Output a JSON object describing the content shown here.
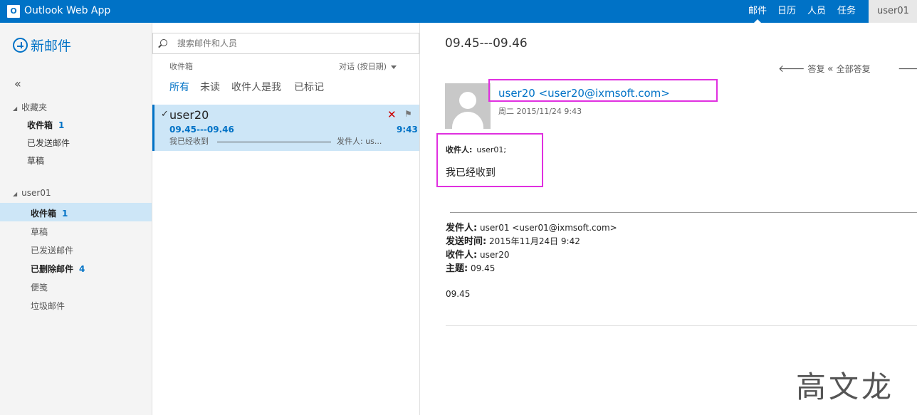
{
  "app": {
    "logo": "O",
    "title": "Outlook Web App"
  },
  "nav": {
    "mail": "邮件",
    "calendar": "日历",
    "people": "人员",
    "tasks": "任务",
    "user": "user01"
  },
  "left": {
    "new_mail": "新邮件",
    "collapse": "«",
    "favorites": {
      "label": "收藏夹",
      "items": [
        {
          "label": "收件箱",
          "count": "1"
        },
        {
          "label": "已发送邮件"
        },
        {
          "label": "草稿"
        }
      ]
    },
    "account": {
      "label": "user01",
      "items": [
        {
          "label": "收件箱",
          "count": "1"
        },
        {
          "label": "草稿"
        },
        {
          "label": "已发送邮件"
        },
        {
          "label": "已删除邮件",
          "count": "4"
        },
        {
          "label": "便笺"
        },
        {
          "label": "垃圾邮件"
        }
      ]
    }
  },
  "list": {
    "search_placeholder": "搜索邮件和人员",
    "folder": "收件箱",
    "sort": "对话 (按日期)",
    "filters": [
      "所有",
      "未读",
      "收件人是我",
      "已标记"
    ],
    "message": {
      "check": "✓",
      "from": "user20",
      "subject": "09.45---09.46",
      "time": "9:43",
      "preview": "我已经收到",
      "preview_tail": "发件人: us...",
      "delete": "✕",
      "flag": "⚑"
    }
  },
  "reading": {
    "subject": "09.45---09.46",
    "actions": {
      "reply": "答复",
      "reply_all": "全部答复"
    },
    "sender": "user20 <user20@ixmsoft.com>",
    "date": "周二 2015/11/24 9:43",
    "to_label": "收件人:",
    "to_value": "user01;",
    "body": "我已经收到",
    "quoted": {
      "from_label": "发件人:",
      "from_value": "user01 <user01@ixmsoft.com>",
      "sent_label": "发送时间:",
      "sent_value": "2015年11月24日 9:42",
      "to_label": "收件人:",
      "to_value": "user20",
      "subject_label": "主题:",
      "subject_value": "09.45"
    },
    "quoted_body": "09.45"
  },
  "watermark": "高文龙",
  "colors": {
    "brand": "#0072c6",
    "highlight": "#e030e0",
    "selected": "#cde6f7"
  }
}
